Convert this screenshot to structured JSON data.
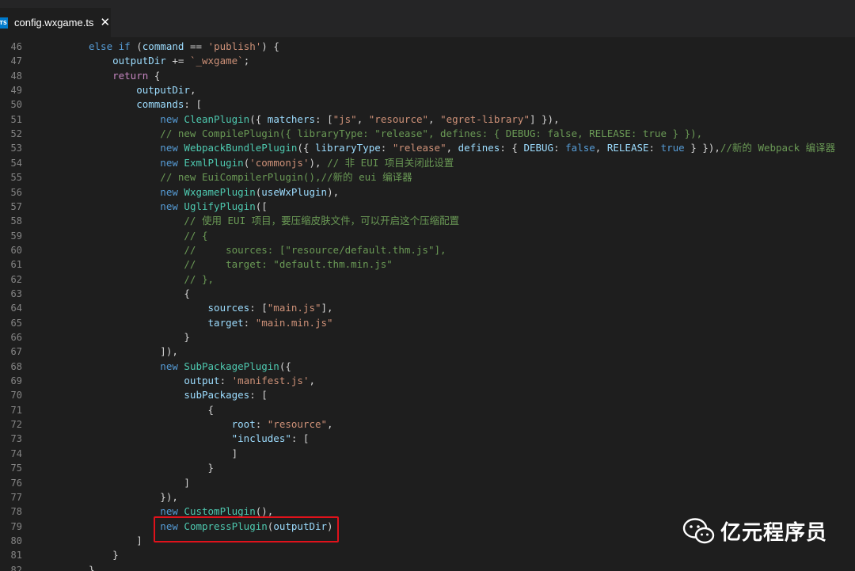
{
  "tab": {
    "file_name": "config.wxgame.ts",
    "icon": "typescript-file-icon",
    "close_glyph": "✕",
    "icon_text": "TS"
  },
  "watermark": {
    "text": "亿元程序员",
    "icon": "wechat-logo-icon"
  },
  "highlight_color": "#e0121b",
  "lines": [
    {
      "n": "46",
      "tokens": [
        [
          "k",
          "else "
        ],
        [
          "k",
          "if"
        ],
        [
          "p",
          " ("
        ],
        [
          "v",
          "command"
        ],
        [
          "p",
          " == "
        ],
        [
          "s",
          "'publish'"
        ],
        [
          "p",
          ") {"
        ]
      ]
    },
    {
      "n": "47",
      "tokens": [
        [
          "v",
          "    outputDir"
        ],
        [
          "p",
          " += "
        ],
        [
          "s",
          "`_wxgame`"
        ],
        [
          "p",
          ";"
        ]
      ]
    },
    {
      "n": "48",
      "tokens": [
        [
          "kc",
          "    return"
        ],
        [
          "p",
          " {"
        ]
      ]
    },
    {
      "n": "49",
      "tokens": [
        [
          "v",
          "        outputDir"
        ],
        [
          "p",
          ","
        ]
      ]
    },
    {
      "n": "50",
      "tokens": [
        [
          "v",
          "        commands"
        ],
        [
          "p",
          ": ["
        ]
      ]
    },
    {
      "n": "51",
      "tokens": [
        [
          "k",
          "            new "
        ],
        [
          "t",
          "CleanPlugin"
        ],
        [
          "p",
          "({ "
        ],
        [
          "v",
          "matchers"
        ],
        [
          "p",
          ": ["
        ],
        [
          "s",
          "\"js\""
        ],
        [
          "p",
          ", "
        ],
        [
          "s",
          "\"resource\""
        ],
        [
          "p",
          ", "
        ],
        [
          "s",
          "\"egret-library\""
        ],
        [
          "p",
          "] }),"
        ]
      ]
    },
    {
      "n": "52",
      "tokens": [
        [
          "c",
          "            // new CompilePlugin({ libraryType: \"release\", defines: { DEBUG: false, RELEASE: true } }),"
        ]
      ]
    },
    {
      "n": "53",
      "tokens": [
        [
          "k",
          "            new "
        ],
        [
          "t",
          "WebpackBundlePlugin"
        ],
        [
          "p",
          "({ "
        ],
        [
          "v",
          "libraryType"
        ],
        [
          "p",
          ": "
        ],
        [
          "s",
          "\"release\""
        ],
        [
          "p",
          ", "
        ],
        [
          "v",
          "defines"
        ],
        [
          "p",
          ": { "
        ],
        [
          "v",
          "DEBUG"
        ],
        [
          "p",
          ": "
        ],
        [
          "k",
          "false"
        ],
        [
          "p",
          ", "
        ],
        [
          "v",
          "RELEASE"
        ],
        [
          "p",
          ": "
        ],
        [
          "k",
          "true"
        ],
        [
          "p",
          " } }),"
        ],
        [
          "c",
          "//新的 Webpack 编译器"
        ]
      ]
    },
    {
      "n": "54",
      "tokens": [
        [
          "k",
          "            new "
        ],
        [
          "t",
          "ExmlPlugin"
        ],
        [
          "p",
          "("
        ],
        [
          "s",
          "'commonjs'"
        ],
        [
          "p",
          "), "
        ],
        [
          "c",
          "// 非 EUI 项目关闭此设置"
        ]
      ]
    },
    {
      "n": "55",
      "tokens": [
        [
          "c",
          "            // new EuiCompilerPlugin(),//新的 eui 编译器"
        ]
      ]
    },
    {
      "n": "56",
      "tokens": [
        [
          "k",
          "            new "
        ],
        [
          "t",
          "WxgamePlugin"
        ],
        [
          "p",
          "("
        ],
        [
          "v",
          "useWxPlugin"
        ],
        [
          "p",
          "),"
        ]
      ]
    },
    {
      "n": "57",
      "tokens": [
        [
          "k",
          "            new "
        ],
        [
          "t",
          "UglifyPlugin"
        ],
        [
          "p",
          "(["
        ]
      ]
    },
    {
      "n": "58",
      "tokens": [
        [
          "c",
          "                // 使用 EUI 项目，要压缩皮肤文件，可以开启这个压缩配置"
        ]
      ]
    },
    {
      "n": "59",
      "tokens": [
        [
          "c",
          "                // {"
        ]
      ]
    },
    {
      "n": "60",
      "tokens": [
        [
          "c",
          "                //     sources: [\"resource/default.thm.js\"],"
        ]
      ]
    },
    {
      "n": "61",
      "tokens": [
        [
          "c",
          "                //     target: \"default.thm.min.js\""
        ]
      ]
    },
    {
      "n": "62",
      "tokens": [
        [
          "c",
          "                // },"
        ]
      ]
    },
    {
      "n": "63",
      "tokens": [
        [
          "p",
          "                {"
        ]
      ]
    },
    {
      "n": "64",
      "tokens": [
        [
          "v",
          "                    sources"
        ],
        [
          "p",
          ": ["
        ],
        [
          "s",
          "\"main.js\""
        ],
        [
          "p",
          "],"
        ]
      ]
    },
    {
      "n": "65",
      "tokens": [
        [
          "v",
          "                    target"
        ],
        [
          "p",
          ": "
        ],
        [
          "s",
          "\"main.min.js\""
        ]
      ]
    },
    {
      "n": "66",
      "tokens": [
        [
          "p",
          "                }"
        ]
      ]
    },
    {
      "n": "67",
      "tokens": [
        [
          "p",
          "            ]),"
        ]
      ]
    },
    {
      "n": "68",
      "tokens": [
        [
          "k",
          "            new "
        ],
        [
          "t",
          "SubPackagePlugin"
        ],
        [
          "p",
          "({"
        ]
      ]
    },
    {
      "n": "69",
      "tokens": [
        [
          "v",
          "                output"
        ],
        [
          "p",
          ": "
        ],
        [
          "s",
          "'manifest.js'"
        ],
        [
          "p",
          ","
        ]
      ]
    },
    {
      "n": "70",
      "tokens": [
        [
          "v",
          "                subPackages"
        ],
        [
          "p",
          ": ["
        ]
      ]
    },
    {
      "n": "71",
      "tokens": [
        [
          "p",
          "                    {"
        ]
      ]
    },
    {
      "n": "72",
      "tokens": [
        [
          "v",
          "                        root"
        ],
        [
          "p",
          ": "
        ],
        [
          "s",
          "\"resource\""
        ],
        [
          "p",
          ","
        ]
      ]
    },
    {
      "n": "73",
      "tokens": [
        [
          "v",
          "                        \"includes\""
        ],
        [
          "p",
          ": ["
        ]
      ]
    },
    {
      "n": "74",
      "tokens": [
        [
          "p",
          "                        ]"
        ]
      ]
    },
    {
      "n": "75",
      "tokens": [
        [
          "p",
          "                    }"
        ]
      ]
    },
    {
      "n": "76",
      "tokens": [
        [
          "p",
          "                ]"
        ]
      ]
    },
    {
      "n": "77",
      "tokens": [
        [
          "p",
          "            }),"
        ]
      ]
    },
    {
      "n": "78",
      "tokens": [
        [
          "k",
          "            new "
        ],
        [
          "t",
          "CustomPlugin"
        ],
        [
          "p",
          "(),"
        ]
      ]
    },
    {
      "n": "79",
      "tokens": [
        [
          "k",
          "            new "
        ],
        [
          "t",
          "CompressPlugin"
        ],
        [
          "p",
          "("
        ],
        [
          "v",
          "outputDir"
        ],
        [
          "p",
          ")"
        ]
      ]
    },
    {
      "n": "80",
      "tokens": [
        [
          "p",
          "        ]"
        ]
      ]
    },
    {
      "n": "81",
      "tokens": [
        [
          "p",
          "    }"
        ]
      ]
    },
    {
      "n": "82",
      "tokens": [
        [
          "p",
          "}"
        ]
      ]
    }
  ]
}
